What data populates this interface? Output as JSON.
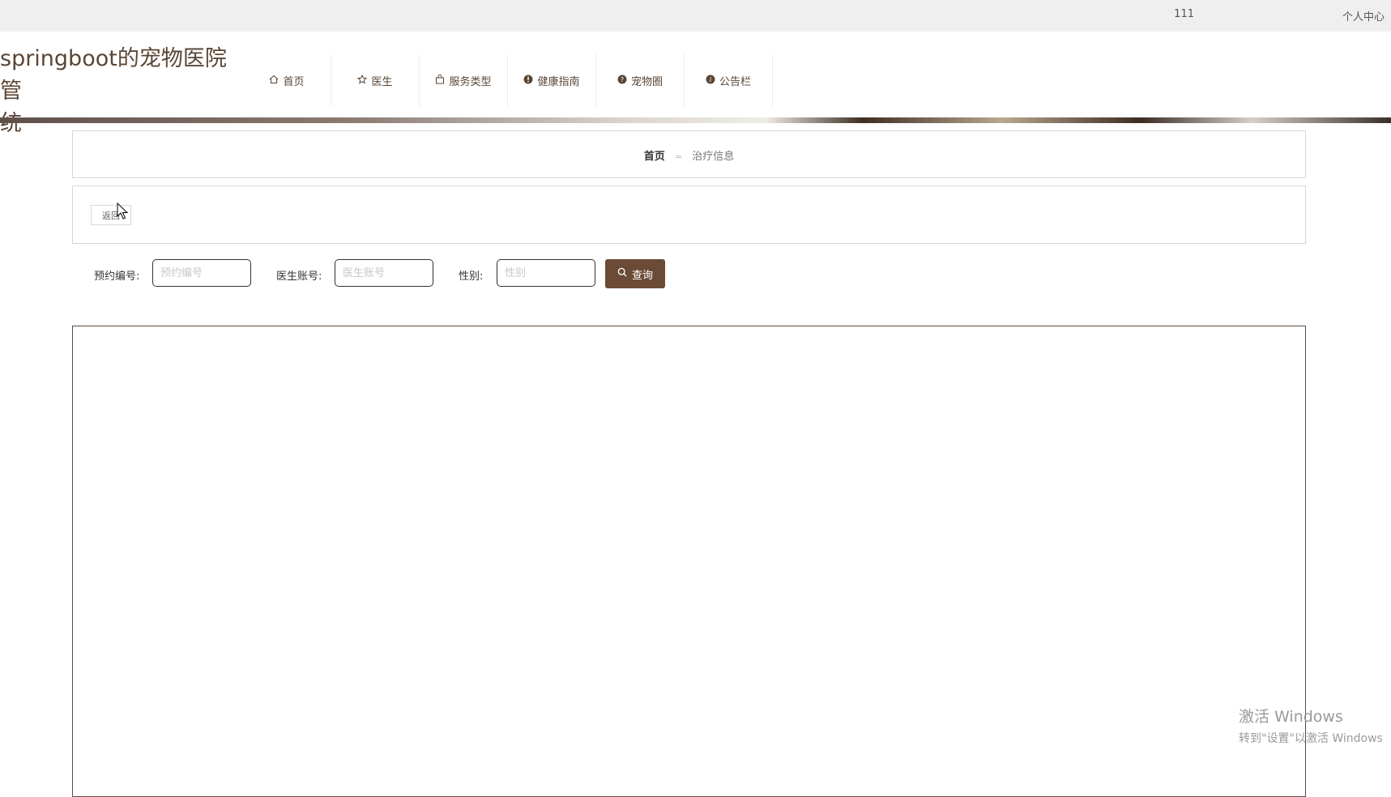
{
  "topbar": {
    "user": "111",
    "personal_center": "个人中心"
  },
  "header": {
    "title_line1": "springboot的宠物医院管",
    "title_line2": "统",
    "nav": [
      {
        "label": "首页",
        "icon": "home-icon"
      },
      {
        "label": "医生",
        "icon": "star-icon"
      },
      {
        "label": "服务类型",
        "icon": "bag-icon"
      },
      {
        "label": "健康指南",
        "icon": "exclamation-icon"
      },
      {
        "label": "宠物圈",
        "icon": "question-icon"
      },
      {
        "label": "公告栏",
        "icon": "info-icon"
      }
    ]
  },
  "breadcrumb": {
    "home": "首页",
    "separator": "=",
    "current": "治疗信息"
  },
  "back_button": "返回",
  "search": {
    "fields": [
      {
        "label": "预约编号:",
        "placeholder": "预约编号",
        "value": ""
      },
      {
        "label": "医生账号:",
        "placeholder": "医生账号",
        "value": ""
      },
      {
        "label": "性别:",
        "placeholder": "性别",
        "value": ""
      }
    ],
    "button": "查询"
  },
  "watermark": {
    "title": "激活 Windows",
    "subtitle": "转到\"设置\"以激活 Windows"
  },
  "colors": {
    "accent": "#6b4b36",
    "title": "#5a4636",
    "topbar_bg": "#efefef"
  }
}
